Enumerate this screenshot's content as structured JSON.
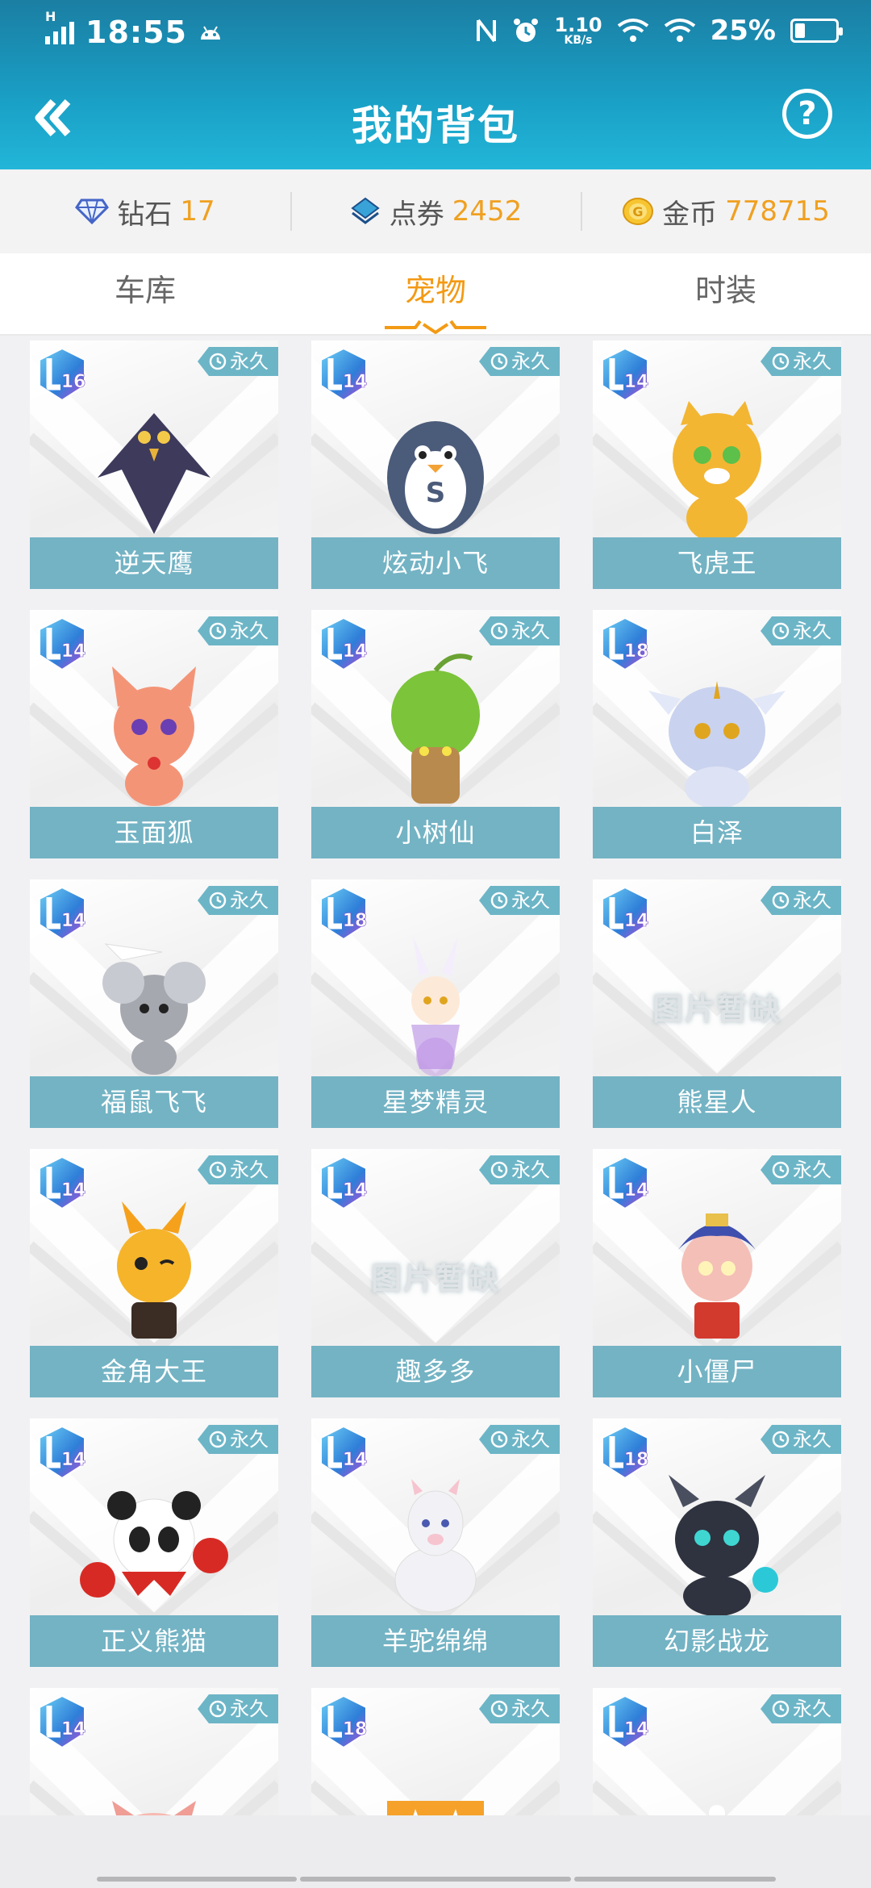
{
  "status_bar": {
    "time": "18:55",
    "net_type": "H",
    "net_speed_value": "1.10",
    "net_speed_unit": "KB/s",
    "battery": "25%",
    "battery_level": 0.25,
    "icons": [
      "signal-icon",
      "android-icon",
      "nfc-icon",
      "alarm-icon",
      "wifi-calling-icon",
      "wifi-icon",
      "battery-icon"
    ]
  },
  "header": {
    "title": "我的背包",
    "back_icon": "double-chevron-left-icon",
    "help_label": "?"
  },
  "currency": [
    {
      "label": "钻石",
      "value": "17",
      "icon": "diamond-icon"
    },
    {
      "label": "点券",
      "value": "2452",
      "icon": "voucher-icon"
    },
    {
      "label": "金币",
      "value": "778715",
      "icon": "coin-icon"
    }
  ],
  "tabs": [
    {
      "label": "车库",
      "active": false
    },
    {
      "label": "宠物",
      "active": true
    },
    {
      "label": "时装",
      "active": false
    }
  ],
  "colors": {
    "header": "#1aa0c6",
    "accent": "#f39a14",
    "name_bar": "#73b3c4"
  },
  "pets": [
    {
      "name": "逆天鹰",
      "level": "16",
      "badge": "永久",
      "art": "eagle",
      "color": "#3d3a5c"
    },
    {
      "name": "炫动小飞",
      "level": "14",
      "badge": "永久",
      "art": "penguin",
      "color": "#4b5b7a"
    },
    {
      "name": "飞虎王",
      "level": "14",
      "badge": "永久",
      "art": "tiger",
      "color": "#f3b633"
    },
    {
      "name": "玉面狐",
      "level": "14",
      "badge": "永久",
      "art": "fox",
      "color": "#f49477"
    },
    {
      "name": "小树仙",
      "level": "14",
      "badge": "永久",
      "art": "tree",
      "color": "#7cc43a"
    },
    {
      "name": "白泽",
      "level": "18",
      "badge": "永久",
      "art": "baize",
      "color": "#c9d3ef"
    },
    {
      "name": "福鼠飞飞",
      "level": "14",
      "badge": "永久",
      "art": "mouse",
      "color": "#a6a8b0"
    },
    {
      "name": "星梦精灵",
      "level": "18",
      "badge": "永久",
      "art": "spirit",
      "color": "#c7a8e8"
    },
    {
      "name": "熊星人",
      "level": "14",
      "badge": "永久",
      "art": "missing",
      "color": ""
    },
    {
      "name": "金角大王",
      "level": "14",
      "badge": "永久",
      "art": "golden-horn",
      "color": "#f5b42a"
    },
    {
      "name": "趣多多",
      "level": "14",
      "badge": "永久",
      "art": "missing",
      "color": ""
    },
    {
      "name": "小僵尸",
      "level": "14",
      "badge": "永久",
      "art": "zombie",
      "color": "#3e4fae"
    },
    {
      "name": "正义熊猫",
      "level": "14",
      "badge": "永久",
      "art": "panda",
      "color": "#222222"
    },
    {
      "name": "羊驼绵绵",
      "level": "14",
      "badge": "永久",
      "art": "alpaca",
      "color": "#f2f2f6"
    },
    {
      "name": "幻影战龙",
      "level": "18",
      "badge": "永久",
      "art": "dragon",
      "color": "#2f3340"
    },
    {
      "name": "",
      "level": "14",
      "badge": "永久",
      "art": "pig",
      "color": "#f7b9b0"
    },
    {
      "name": "",
      "level": "18",
      "badge": "永久",
      "art": "rabbit",
      "color": "#f5a12a"
    },
    {
      "name": "",
      "level": "14",
      "badge": "永久",
      "art": "snowman",
      "color": "#e8eefc"
    }
  ],
  "missing_image_text": "图片暂缺"
}
